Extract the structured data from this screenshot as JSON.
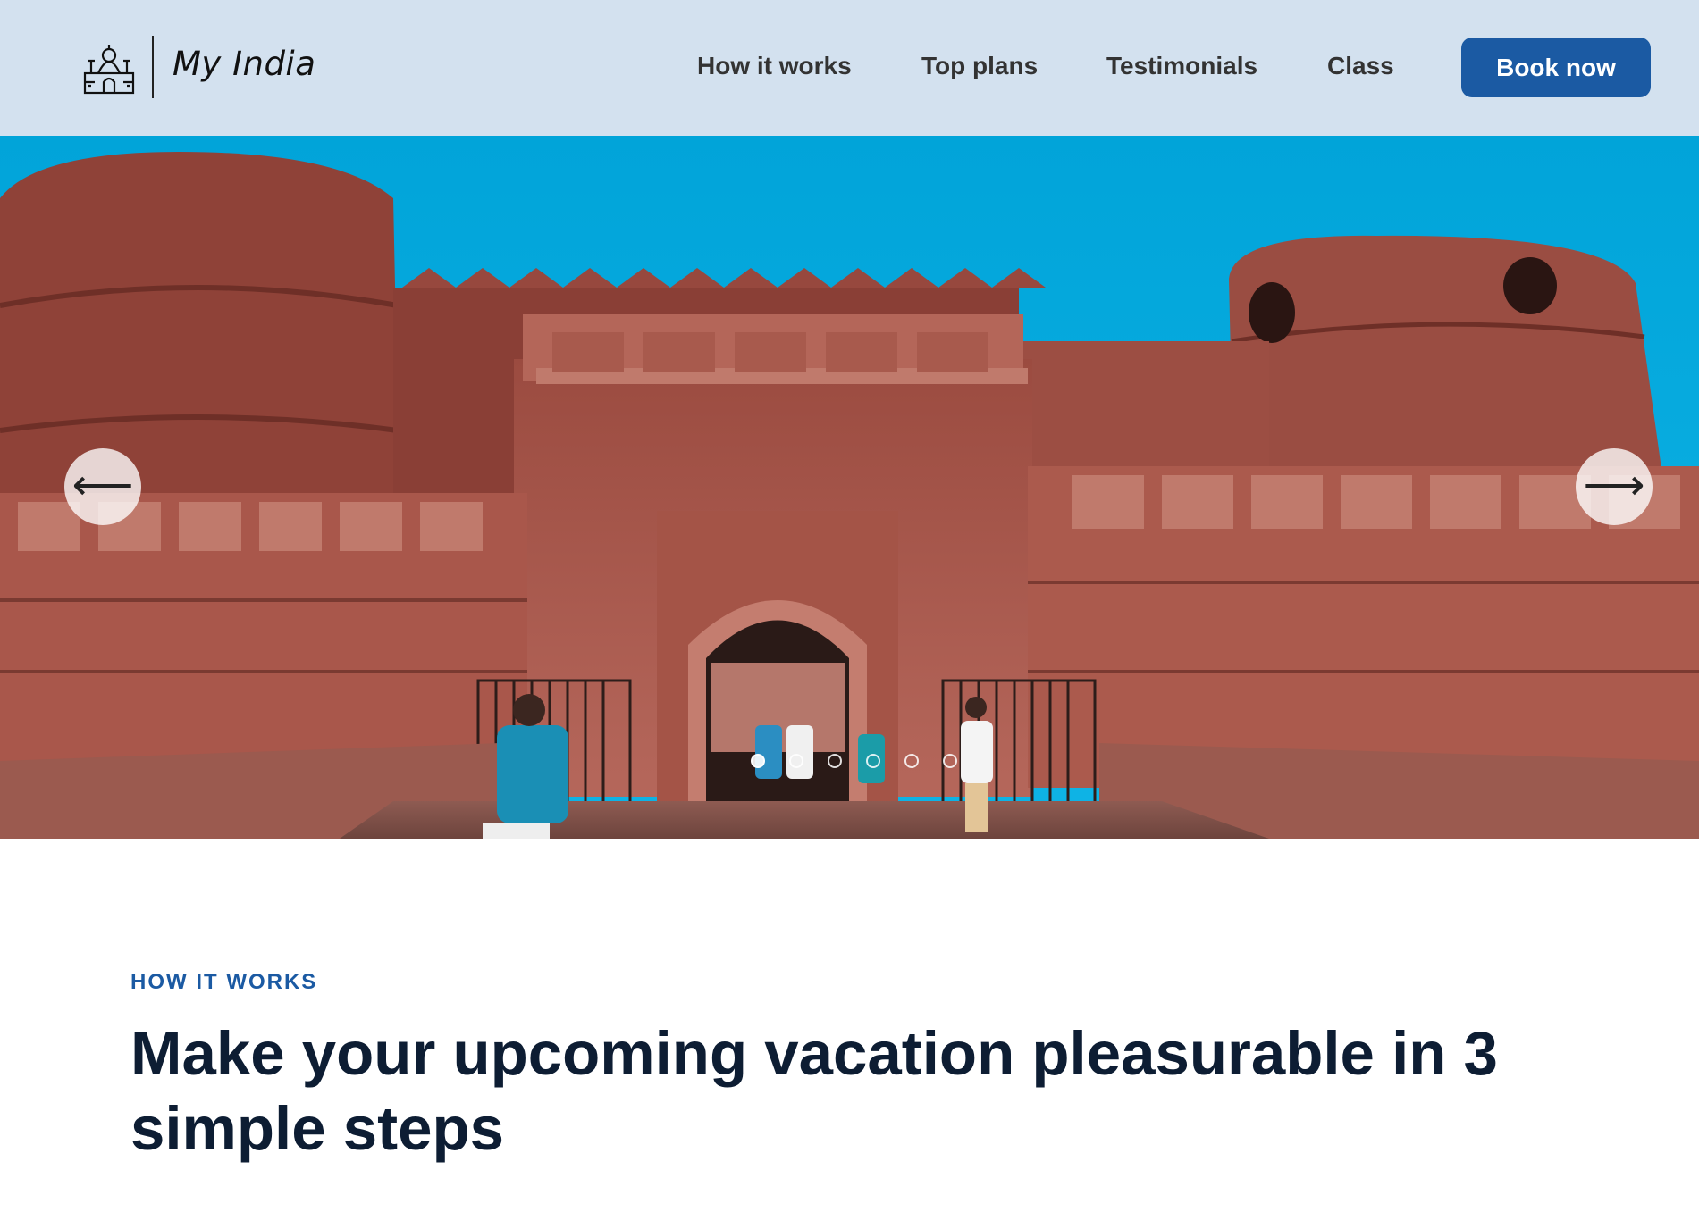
{
  "header": {
    "brand": "My India",
    "logo_icon": "india-monument-icon",
    "nav": [
      {
        "label": "How it works"
      },
      {
        "label": "Top plans"
      },
      {
        "label": "Testimonials"
      },
      {
        "label": "Class"
      }
    ],
    "cta_label": "Book now"
  },
  "hero": {
    "prev_icon": "arrow-left-icon",
    "next_icon": "arrow-right-icon",
    "prev_glyph": "⟵",
    "next_glyph": "⟶",
    "slide_count": 6,
    "active_slide": 1
  },
  "section": {
    "eyebrow": "HOW IT WORKS",
    "title": "Make your upcoming vacation pleasurable in 3 simple steps"
  },
  "colors": {
    "header_bg": "#d3e1ef",
    "accent": "#1b5aa3",
    "sky": "#02a6dc",
    "sandstone": "#a8564a",
    "heading": "#0d1d33"
  }
}
